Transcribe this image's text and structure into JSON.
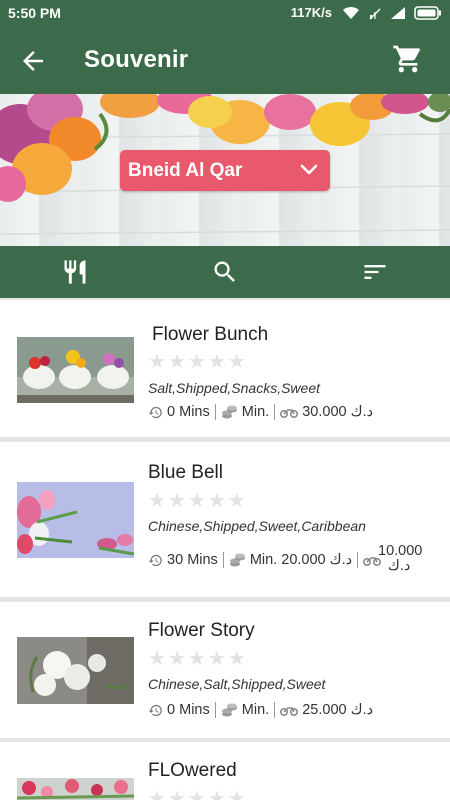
{
  "status_bar": {
    "time": "5:50 PM",
    "network_speed": "117K/s",
    "icons": [
      "wifi-icon",
      "sim-icon",
      "signal-icon",
      "battery-icon"
    ]
  },
  "app_bar": {
    "title": "Souvenir",
    "back_icon": "arrow-left-icon",
    "cart_icon": "shopping-cart-icon"
  },
  "location": {
    "selected": "Bneid Al Qar",
    "icon": "chevron-down-icon"
  },
  "filters": {
    "icons": [
      "cutlery-icon",
      "search-icon",
      "sort-icon"
    ]
  },
  "colors": {
    "primary": "#3b6b4a",
    "accent": "#e8596b",
    "star_empty": "#e2e2e2"
  },
  "shops": [
    {
      "name": "Flower Bunch",
      "rating": 0,
      "tags": "Salt,Shipped,Snacks,Sweet",
      "delivery_time": "0 Mins",
      "min_order": "Min.",
      "delivery_fee": "30.000 د.ك"
    },
    {
      "name": "Blue Bell",
      "rating": 0,
      "tags": "Chinese,Shipped,Sweet,Caribbean",
      "delivery_time": "30 Mins",
      "min_order": "Min. 20.000 د.ك",
      "delivery_fee_line1": "10.000",
      "delivery_fee_line2": "د.ك"
    },
    {
      "name": "Flower Story",
      "rating": 0,
      "tags": "Chinese,Salt,Shipped,Sweet",
      "delivery_time": "0 Mins",
      "min_order": "Min.",
      "delivery_fee": "25.000 د.ك"
    },
    {
      "name": "FLOwered",
      "rating": 0
    }
  ]
}
